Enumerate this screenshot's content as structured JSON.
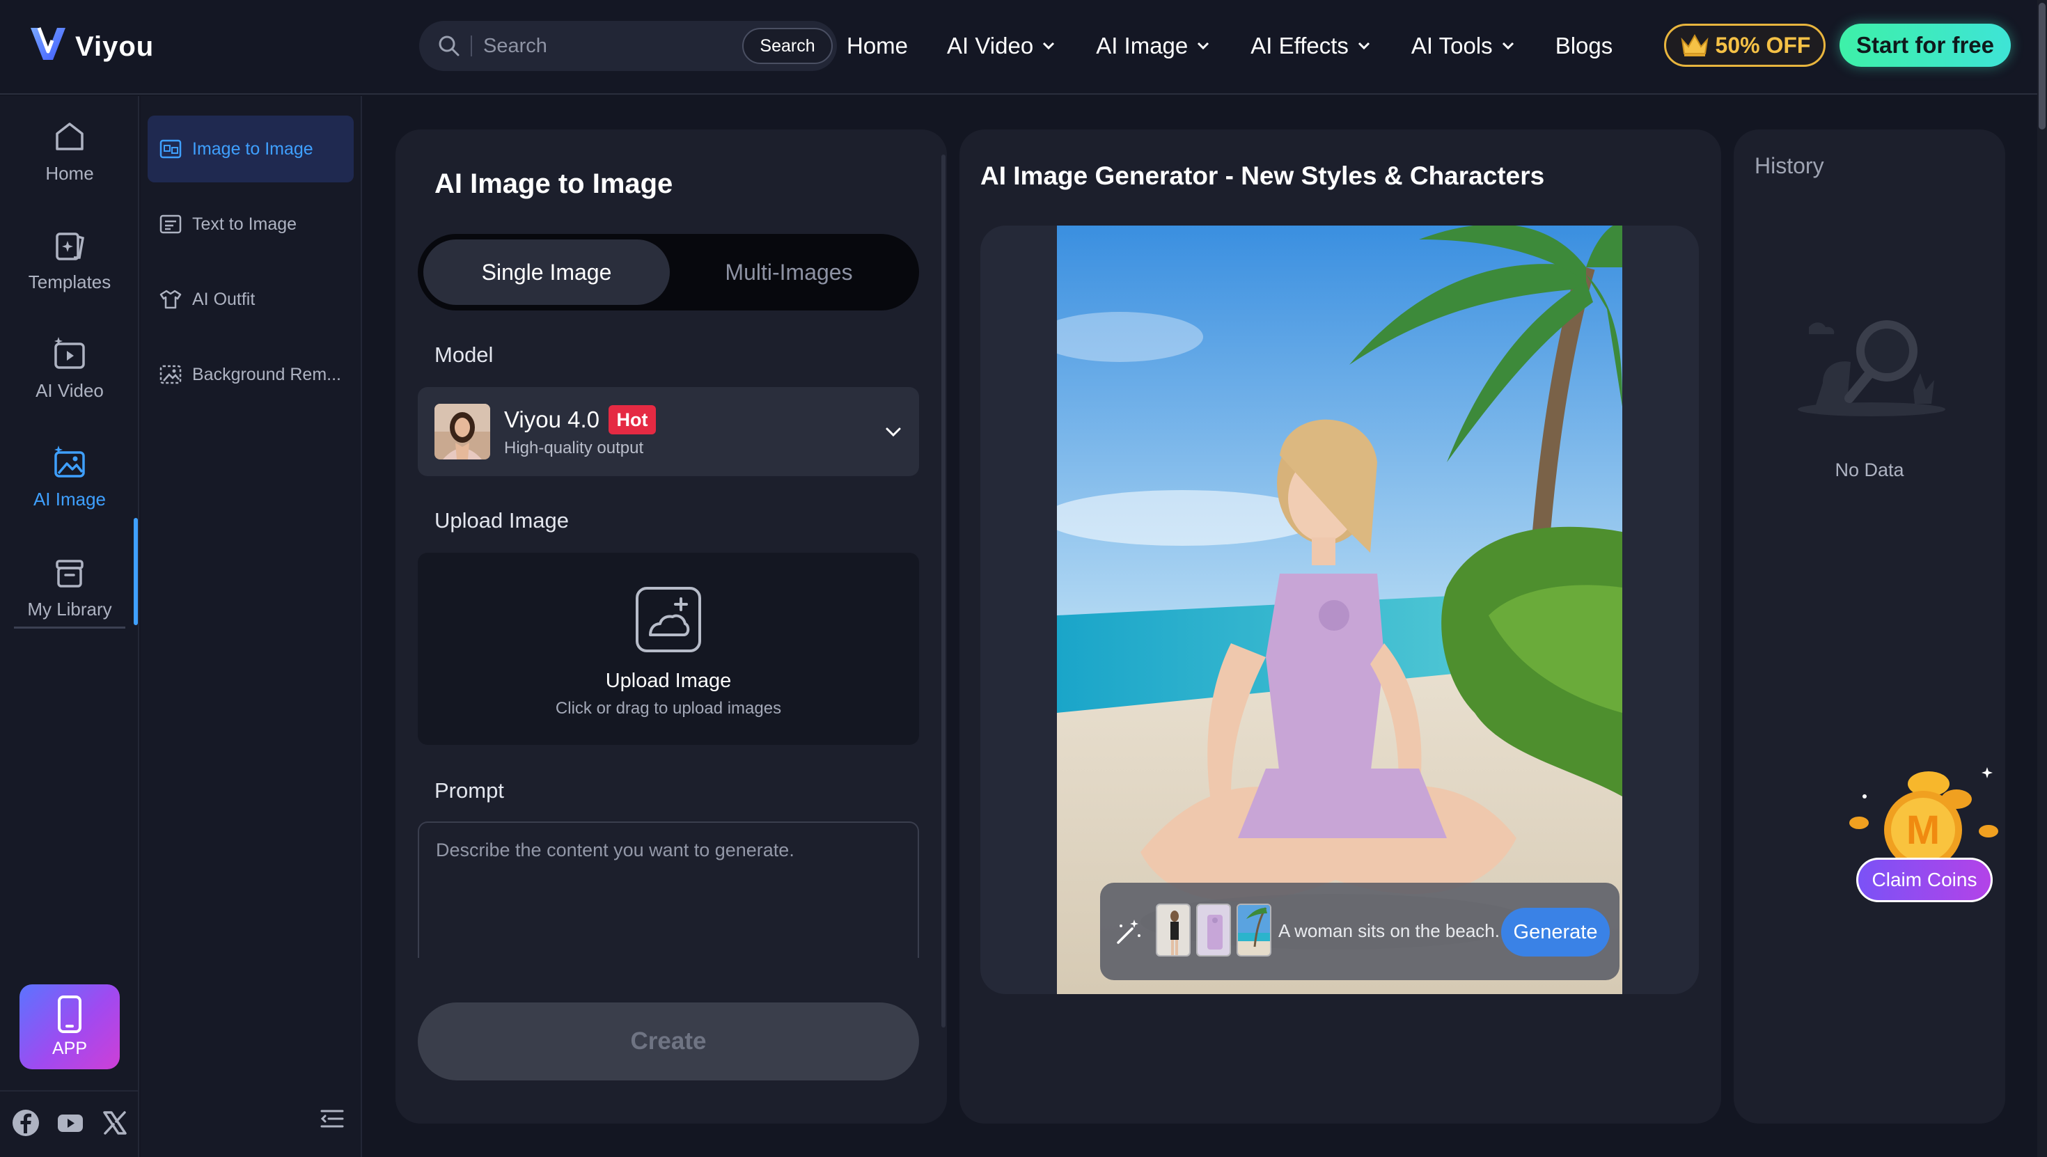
{
  "brand": {
    "name": "Viyou"
  },
  "search": {
    "placeholder": "Search",
    "button_label": "Search"
  },
  "nav": {
    "items": [
      {
        "label": "Home",
        "dropdown": false
      },
      {
        "label": "AI Video",
        "dropdown": true
      },
      {
        "label": "AI Image",
        "dropdown": true
      },
      {
        "label": "AI Effects",
        "dropdown": true
      },
      {
        "label": "AI Tools",
        "dropdown": true
      },
      {
        "label": "Blogs",
        "dropdown": false
      }
    ],
    "promo_label": "50% OFF",
    "cta_label": "Start for free"
  },
  "sidebar": {
    "items": [
      {
        "label": "Home",
        "icon": "home-icon"
      },
      {
        "label": "Templates",
        "icon": "templates-icon"
      },
      {
        "label": "AI Video",
        "icon": "ai-video-icon"
      },
      {
        "label": "AI Image",
        "icon": "ai-image-icon",
        "active": true
      },
      {
        "label": "My Library",
        "icon": "library-icon"
      }
    ],
    "app_label": "APP",
    "social": [
      "facebook-icon",
      "youtube-icon",
      "x-icon"
    ]
  },
  "subnav": {
    "items": [
      {
        "label": "Image to Image",
        "icon": "image-to-image-icon",
        "active": true
      },
      {
        "label": "Text to Image",
        "icon": "text-to-image-icon"
      },
      {
        "label": "AI Outfit",
        "icon": "outfit-icon"
      },
      {
        "label": "Background Rem...",
        "icon": "background-remove-icon"
      }
    ]
  },
  "form": {
    "title": "AI Image to Image",
    "modes": [
      "Single Image",
      "Multi-Images"
    ],
    "active_mode": "Single Image",
    "model_label": "Model",
    "model": {
      "name": "Viyou 4.0",
      "badge": "Hot",
      "subtitle": "High-quality output"
    },
    "upload_label": "Upload Image",
    "upload_title": "Upload Image",
    "upload_hint": "Click or drag to upload images",
    "prompt_label": "Prompt",
    "prompt_placeholder": "Describe the content you want to generate.",
    "create_label": "Create"
  },
  "preview": {
    "title": "AI Image Generator - New Styles & Characters",
    "example_prompt": "A woman sits on the beach.",
    "generate_label": "Generate"
  },
  "history": {
    "title": "History",
    "empty_text": "No Data"
  },
  "coins": {
    "claim_label": "Claim Coins"
  },
  "colors": {
    "accent": "#3fa0ff",
    "cta": "#3ef0a8",
    "promo": "#f5c146",
    "hot": "#e52a43",
    "background": "#131622",
    "panel": "#1c1f2c"
  }
}
